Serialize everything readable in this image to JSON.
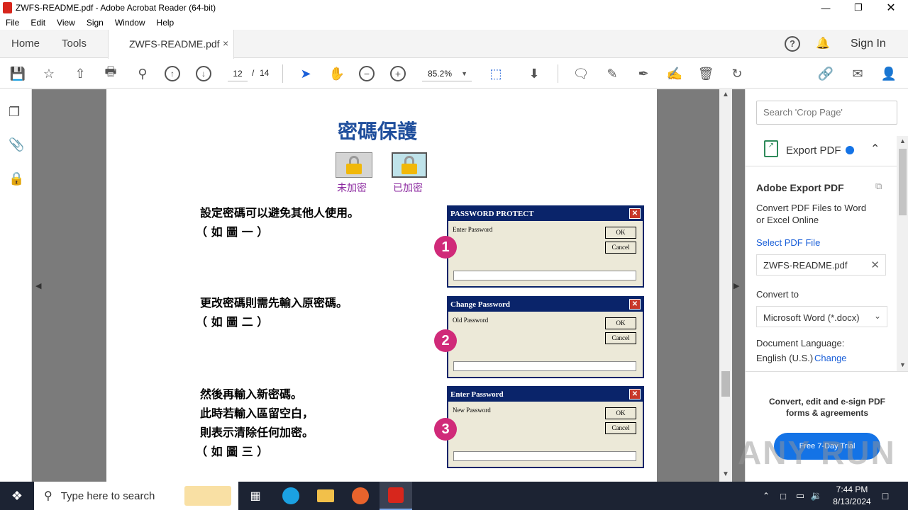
{
  "window": {
    "title": "ZWFS-README.pdf - Adobe Acrobat Reader (64-bit)"
  },
  "menu": [
    "File",
    "Edit",
    "View",
    "Sign",
    "Window",
    "Help"
  ],
  "tabs": {
    "home": "Home",
    "tools": "Tools",
    "document": "ZWFS-README.pdf",
    "close": "×"
  },
  "header": {
    "sign_in": "Sign In"
  },
  "toolbar": {
    "page_current": "12",
    "page_sep": "/",
    "page_total": "14",
    "zoom": "85.2%"
  },
  "doc": {
    "heading": "密碼保護",
    "lock_unlocked": "未加密",
    "lock_locked": "已加密",
    "block1": {
      "lines": [
        "設定密碼可以避免其他人使用。",
        "（ 如 圖 一 ）"
      ]
    },
    "block2": {
      "lines": [
        "更改密碼則需先輸入原密碼。",
        "（ 如 圖 二 ）"
      ]
    },
    "block3": {
      "lines": [
        "然後再輸入新密碼。",
        "此時若輸入區留空白，",
        "則表示清除任何加密。",
        "（ 如 圖 三 ）"
      ]
    },
    "dialogs": [
      {
        "num": "1",
        "title": "PASSWORD PROTECT",
        "label": "Enter Password",
        "ok": "OK",
        "cancel": "Cancel"
      },
      {
        "num": "2",
        "title": "Change Password",
        "label": "Old Password",
        "ok": "OK",
        "cancel": "Cancel"
      },
      {
        "num": "3",
        "title": "Enter Password",
        "label": "New Password",
        "ok": "OK",
        "cancel": "Cancel"
      }
    ]
  },
  "right_panel": {
    "search_placeholder": "Search 'Crop Page'",
    "export_title": "Export PDF",
    "section_title": "Adobe Export PDF",
    "desc": "Convert PDF Files to Word or Excel Online",
    "select_link": "Select PDF File",
    "file_name": "ZWFS-README.pdf",
    "convert_to": "Convert to",
    "format": "Microsoft Word (*.docx)",
    "doc_lang_label": "Document Language:",
    "doc_lang_value": "English (U.S.)",
    "change_link": "Change",
    "promo": "Convert, edit and e-sign PDF forms & agreements",
    "trial_button": "Free 7-Day Trial"
  },
  "taskbar": {
    "search_placeholder": "Type here to search",
    "time": "7:44 PM",
    "date": "8/13/2024"
  },
  "watermark": "ANY RUN"
}
